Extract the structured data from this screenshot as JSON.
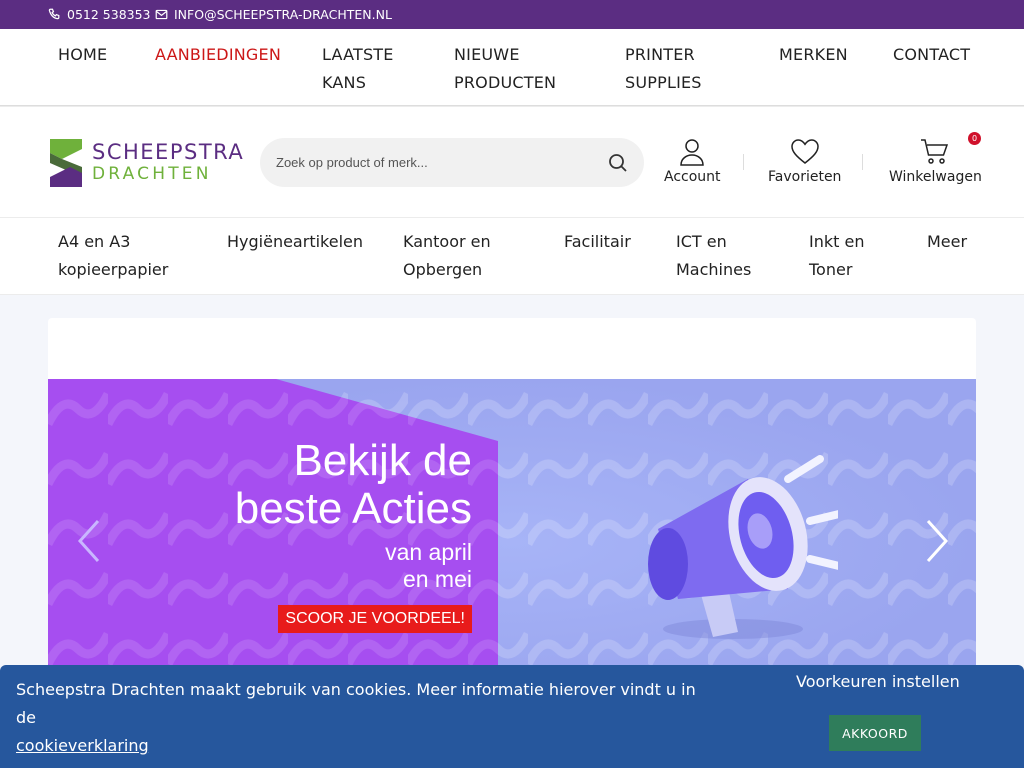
{
  "topbar": {
    "phone": "0512 538353",
    "email": "INFO@SCHEEPSTRA-DRACHTEN.NL"
  },
  "main_nav": [
    {
      "label": "HOME",
      "active": false
    },
    {
      "label": "AANBIEDINGEN",
      "active": true
    },
    {
      "label": "LAATSTE KANS",
      "active": false
    },
    {
      "label": "NIEUWE PRODUCTEN",
      "active": false
    },
    {
      "label": "PRINTER SUPPLIES",
      "active": false
    },
    {
      "label": "MERKEN",
      "active": false
    },
    {
      "label": "CONTACT",
      "active": false
    }
  ],
  "logo": {
    "line1": "SCHEEPSTRA",
    "line2": "DRACHTEN"
  },
  "search": {
    "placeholder": "Zoek op product of merk..."
  },
  "header_actions": {
    "account": "Account",
    "favorites": "Favorieten",
    "cart": "Winkelwagen",
    "cart_count": "0"
  },
  "category_nav": [
    {
      "label": "A4 en A3 kopieerpapier"
    },
    {
      "label": "Hygiëneartikelen"
    },
    {
      "label": "Kantoor en Opbergen"
    },
    {
      "label": "Facilitair"
    },
    {
      "label": "ICT en Machines"
    },
    {
      "label": "Inkt en Toner"
    },
    {
      "label": "Meer"
    }
  ],
  "banner": {
    "line1": "Bekijk de",
    "line2": "beste Acties",
    "line3": "van april",
    "line4": "en mei",
    "cta": "SCOOR JE VOORDEEL!"
  },
  "cookie": {
    "message": "Scheepstra Drachten maakt gebruik van cookies. Meer informatie hierover vindt u in de",
    "link": "cookieverklaring",
    "preferences": "Voorkeuren instellen",
    "accept": "AKKOORD"
  },
  "colors": {
    "brand_purple": "#5b2d82",
    "brand_green": "#6fb13b",
    "active_nav": "#cc1717",
    "cookie_bar": "#26579d",
    "accept_button": "#2f7d5b",
    "cta_red": "#e81b1b"
  }
}
